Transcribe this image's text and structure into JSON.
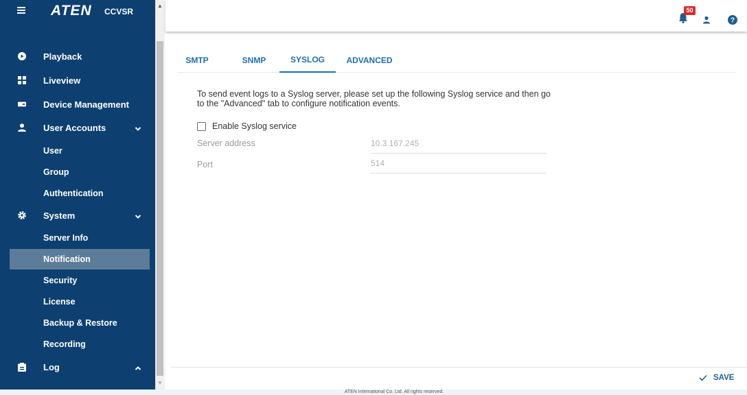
{
  "brand": {
    "logo": "ATEN",
    "product": "CCVSR"
  },
  "sidebar": {
    "items": [
      {
        "label": "Playback",
        "icon": "play-icon"
      },
      {
        "label": "Liveview",
        "icon": "grid-icon"
      },
      {
        "label": "Device Management",
        "icon": "device-icon"
      },
      {
        "label": "User Accounts",
        "icon": "user-icon",
        "children": [
          "User",
          "Group",
          "Authentication"
        ]
      },
      {
        "label": "System",
        "icon": "gear-icon",
        "children": [
          "Server Info",
          "Notification",
          "Security",
          "License",
          "Backup & Restore",
          "Recording"
        ]
      },
      {
        "label": "Log",
        "icon": "clipboard-icon"
      }
    ],
    "active_item": "Notification"
  },
  "topbar": {
    "notification_count": "50"
  },
  "tabs": {
    "items": [
      "SMTP",
      "SNMP",
      "SYSLOG",
      "ADVANCED"
    ],
    "active": "SYSLOG"
  },
  "content": {
    "description": "To send event logs to a Syslog server, please set up the following Syslog service and then go to the \"Advanced\" tab to configure notification events.",
    "enable_label": "Enable Syslog service",
    "enable_checked": false,
    "server_address_label": "Server address",
    "server_address_value": "10.3.167.245",
    "port_label": "Port",
    "port_value": "514"
  },
  "actions": {
    "save_label": "SAVE"
  },
  "footer": {
    "copyright": "ATEN International Co. Ltd. All rights reserved."
  },
  "colors": {
    "sidebar": "#0d3f70",
    "active_item": "#5d7c99",
    "accent": "#1f6fad",
    "badge": "#d32f2f"
  }
}
